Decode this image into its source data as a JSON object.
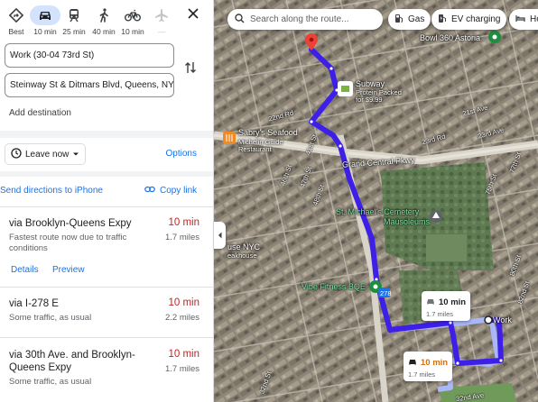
{
  "modes": [
    {
      "id": "best",
      "label": "Best",
      "icon": "diamond-directions-icon"
    },
    {
      "id": "drive",
      "label": "10 min",
      "icon": "car-icon",
      "active": true
    },
    {
      "id": "transit",
      "label": "25 min",
      "icon": "train-icon"
    },
    {
      "id": "walk",
      "label": "40 min",
      "icon": "walk-icon"
    },
    {
      "id": "bike",
      "label": "10 min",
      "icon": "bike-icon"
    },
    {
      "id": "flight",
      "label": "—",
      "icon": "plane-icon"
    }
  ],
  "origin": "Work (30-04 73rd St)",
  "destination": "Steinway St & Ditmars Blvd, Queens, NY 1",
  "add_destination": "Add destination",
  "leave_now": "Leave now",
  "options": "Options",
  "send_directions": "Send directions to iPhone",
  "copy_link": "Copy link",
  "routes": [
    {
      "name": "via Brooklyn-Queens Expy",
      "time": "10 min",
      "distance": "1.7 miles",
      "desc": "Fastest route now due to traffic conditions",
      "details": "Details",
      "preview": "Preview"
    },
    {
      "name": "via I-278 E",
      "time": "10 min",
      "distance": "2.2 miles",
      "desc": "Some traffic, as usual"
    },
    {
      "name": "via 30th Ave. and Brooklyn-Queens Expy",
      "time": "10 min",
      "distance": "1.7 miles",
      "desc": "Some traffic, as usual"
    }
  ],
  "map": {
    "search_placeholder": "Search along the route...",
    "chips": [
      "Gas",
      "EV charging",
      "Ho"
    ],
    "labels": {
      "bowl": "Bowl 360 Astoria",
      "subway": "Subway",
      "subway_sub1": "Protein Packed",
      "subway_sub2": "for $9.99",
      "sabrys": "Sabry's Seafood",
      "sabrys_sub1": "Michelin Guide",
      "sabrys_sub2": "Restaurant",
      "grand_central": "Grand Central Pkwy",
      "cemetery1": "St. Michael's Cemetery",
      "cemetery2": "Mausoleums",
      "vibe": "Vibe Fitness BQE",
      "house_nyc": "use NYC",
      "steakhouse": "eakhouse",
      "work": "Work",
      "st_32": "32nd St",
      "ave_21": "21st Ave",
      "ave_23": "23rd Ave",
      "rd_23": "23rd Rd",
      "rd_22": "22nd Rd",
      "st_41": "41st St",
      "st_46": "46th St",
      "st_47": "47th St",
      "st_48": "48th St",
      "st_75": "75th St",
      "st_77": "77th St",
      "st_80": "80th St",
      "st_82": "82nd St",
      "ave_32": "32nd Ave",
      "i278": "278"
    },
    "callouts": [
      {
        "time": "10 min",
        "distance": "1.7 miles",
        "selected": false
      },
      {
        "time": "10 min",
        "distance": "1.7 miles",
        "selected": true
      }
    ]
  },
  "colors": {
    "route_primary": "#3d1fe8",
    "route_alt": "#a9b6f7",
    "link_blue": "#1a73e8",
    "time_red": "#c5221f",
    "time_orange": "#d56e0c",
    "active_mode_bg": "#d3e3fd"
  }
}
